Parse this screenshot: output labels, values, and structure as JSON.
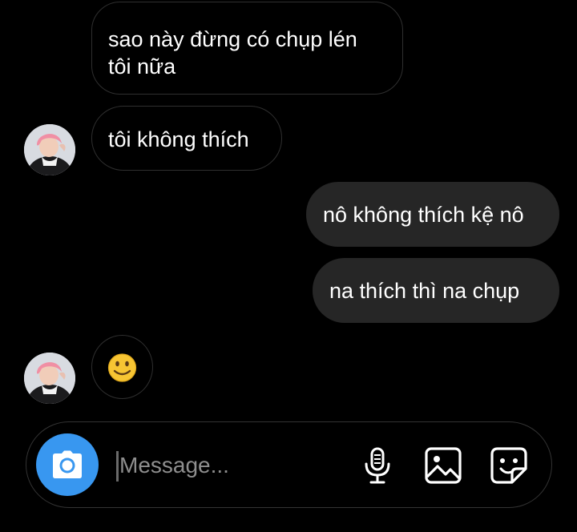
{
  "messages": [
    {
      "lines": [
        "sao này đừng có chụp lén",
        "tôi nữa"
      ],
      "direction": "incoming"
    },
    {
      "text": "tôi không thích",
      "direction": "incoming"
    },
    {
      "text": "nô không thích kệ nô",
      "direction": "outgoing"
    },
    {
      "text": "na thích thì na chụp",
      "direction": "outgoing"
    },
    {
      "text": "🙂",
      "direction": "incoming"
    }
  ],
  "composer": {
    "placeholder": "Message...",
    "value": "",
    "camera_icon": "camera-icon",
    "mic_icon": "microphone-icon",
    "gallery_icon": "image-gallery-icon",
    "sticker_icon": "sticker-icon"
  },
  "colors": {
    "background": "#000000",
    "outgoing_bubble": "#262626",
    "incoming_border": "#2f2f2f",
    "camera_button": "#3897f0",
    "placeholder_text": "#8e8e8e"
  }
}
